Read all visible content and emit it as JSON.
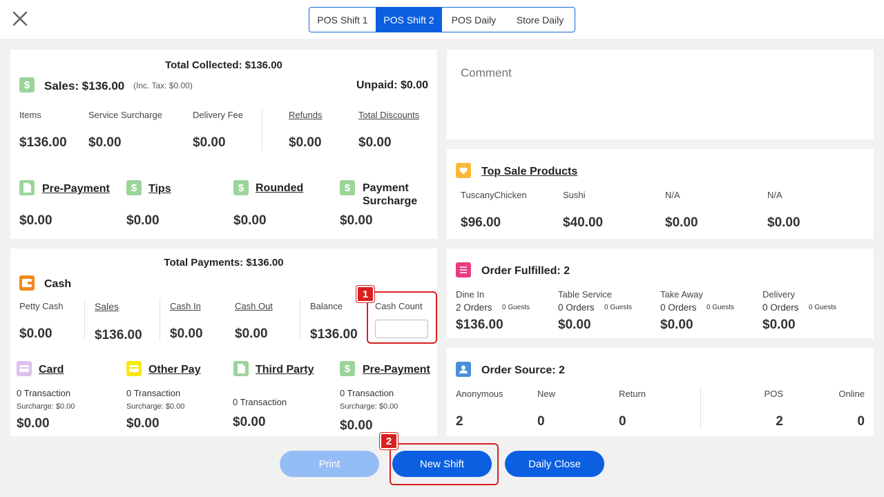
{
  "tabs": [
    {
      "label": "POS Shift 1",
      "active": false
    },
    {
      "label": "POS Shift 2",
      "active": true
    },
    {
      "label": "POS Daily",
      "active": false
    },
    {
      "label": "Store Daily",
      "active": false
    }
  ],
  "summary": {
    "total_collected": "Total Collected: $136.00",
    "sales_label": "Sales: $136.00",
    "inc_tax": "(Inc. Tax: $0.00)",
    "unpaid": "Unpaid: $0.00",
    "metrics": [
      {
        "label": "Items",
        "value": "$136.00"
      },
      {
        "label": "Service Surcharge",
        "value": "$0.00"
      },
      {
        "label": "Delivery Fee",
        "value": "$0.00"
      },
      {
        "label": "Refunds",
        "value": "$0.00"
      },
      {
        "label": "Total Discounts",
        "value": "$0.00"
      }
    ],
    "extras": [
      {
        "label": "Pre-Payment",
        "value": "$0.00"
      },
      {
        "label": "Tips",
        "value": "$0.00"
      },
      {
        "label": "Rounded",
        "value": "$0.00"
      },
      {
        "label": "Payment",
        "label2": "Surcharge",
        "value": "$0.00"
      }
    ]
  },
  "payments": {
    "total": "Total Payments: $136.00",
    "cash_title": "Cash",
    "cash_items": [
      {
        "label": "Petty Cash",
        "value": "$0.00"
      },
      {
        "label": "Sales",
        "value": "$136.00"
      },
      {
        "label": "Cash In",
        "value": "$0.00"
      },
      {
        "label": "Cash Out",
        "value": "$0.00"
      },
      {
        "label": "Balance",
        "value": "$136.00"
      }
    ],
    "cash_count_label": "Cash Count",
    "cash_count_value": "",
    "methods": [
      {
        "label": "Card",
        "transactions": "0 Transaction",
        "surcharge": "Surcharge: $0.00",
        "value": "$0.00"
      },
      {
        "label": "Other Pay",
        "transactions": "0 Transaction",
        "surcharge": "Surcharge: $0.00",
        "value": "$0.00"
      },
      {
        "label": "Third Party",
        "transactions": "0 Transaction",
        "value": "$0.00"
      },
      {
        "label": "Pre-Payment",
        "transactions": "0 Transaction",
        "surcharge": "Surcharge: $0.00",
        "value": "$0.00"
      }
    ]
  },
  "comment": {
    "placeholder": "Comment"
  },
  "top_sale": {
    "title": "Top Sale Products",
    "items": [
      {
        "name": "TuscanyChicken",
        "value": "$96.00"
      },
      {
        "name": "Sushi",
        "value": "$40.00"
      },
      {
        "name": "N/A",
        "value": "$0.00"
      },
      {
        "name": "N/A",
        "value": "$0.00"
      }
    ]
  },
  "fulfilled": {
    "title": "Order Fulfilled: 2",
    "items": [
      {
        "label": "Dine In",
        "orders": "2 Orders",
        "guests": "0 Guests",
        "value": "$136.00"
      },
      {
        "label": "Table Service",
        "orders": "0 Orders",
        "guests": "0 Guests",
        "value": "$0.00"
      },
      {
        "label": "Take Away",
        "orders": "0 Orders",
        "guests": "0 Guests",
        "value": "$0.00"
      },
      {
        "label": "Delivery",
        "orders": "0 Orders",
        "guests": "0 Guests",
        "value": "$0.00"
      }
    ]
  },
  "source": {
    "title": "Order Source: 2",
    "items": [
      {
        "label": "Anonymous",
        "value": "2"
      },
      {
        "label": "New",
        "value": "0"
      },
      {
        "label": "Return",
        "value": "0"
      },
      {
        "label": "POS",
        "value": "2"
      },
      {
        "label": "Online",
        "value": "0"
      }
    ]
  },
  "buttons": {
    "print": "Print",
    "new_shift": "New Shift",
    "daily_close": "Daily Close"
  },
  "annotations": {
    "one": "1",
    "two": "2"
  },
  "colors": {
    "accent": "#0b5fe0",
    "annotation": "#d82020"
  },
  "icons": {
    "close": "close-icon",
    "dollar": "dollar-icon",
    "document": "document-icon",
    "wallet": "wallet-icon",
    "card": "card-icon",
    "heart": "heart-icon",
    "list": "list-icon",
    "people": "people-icon"
  }
}
